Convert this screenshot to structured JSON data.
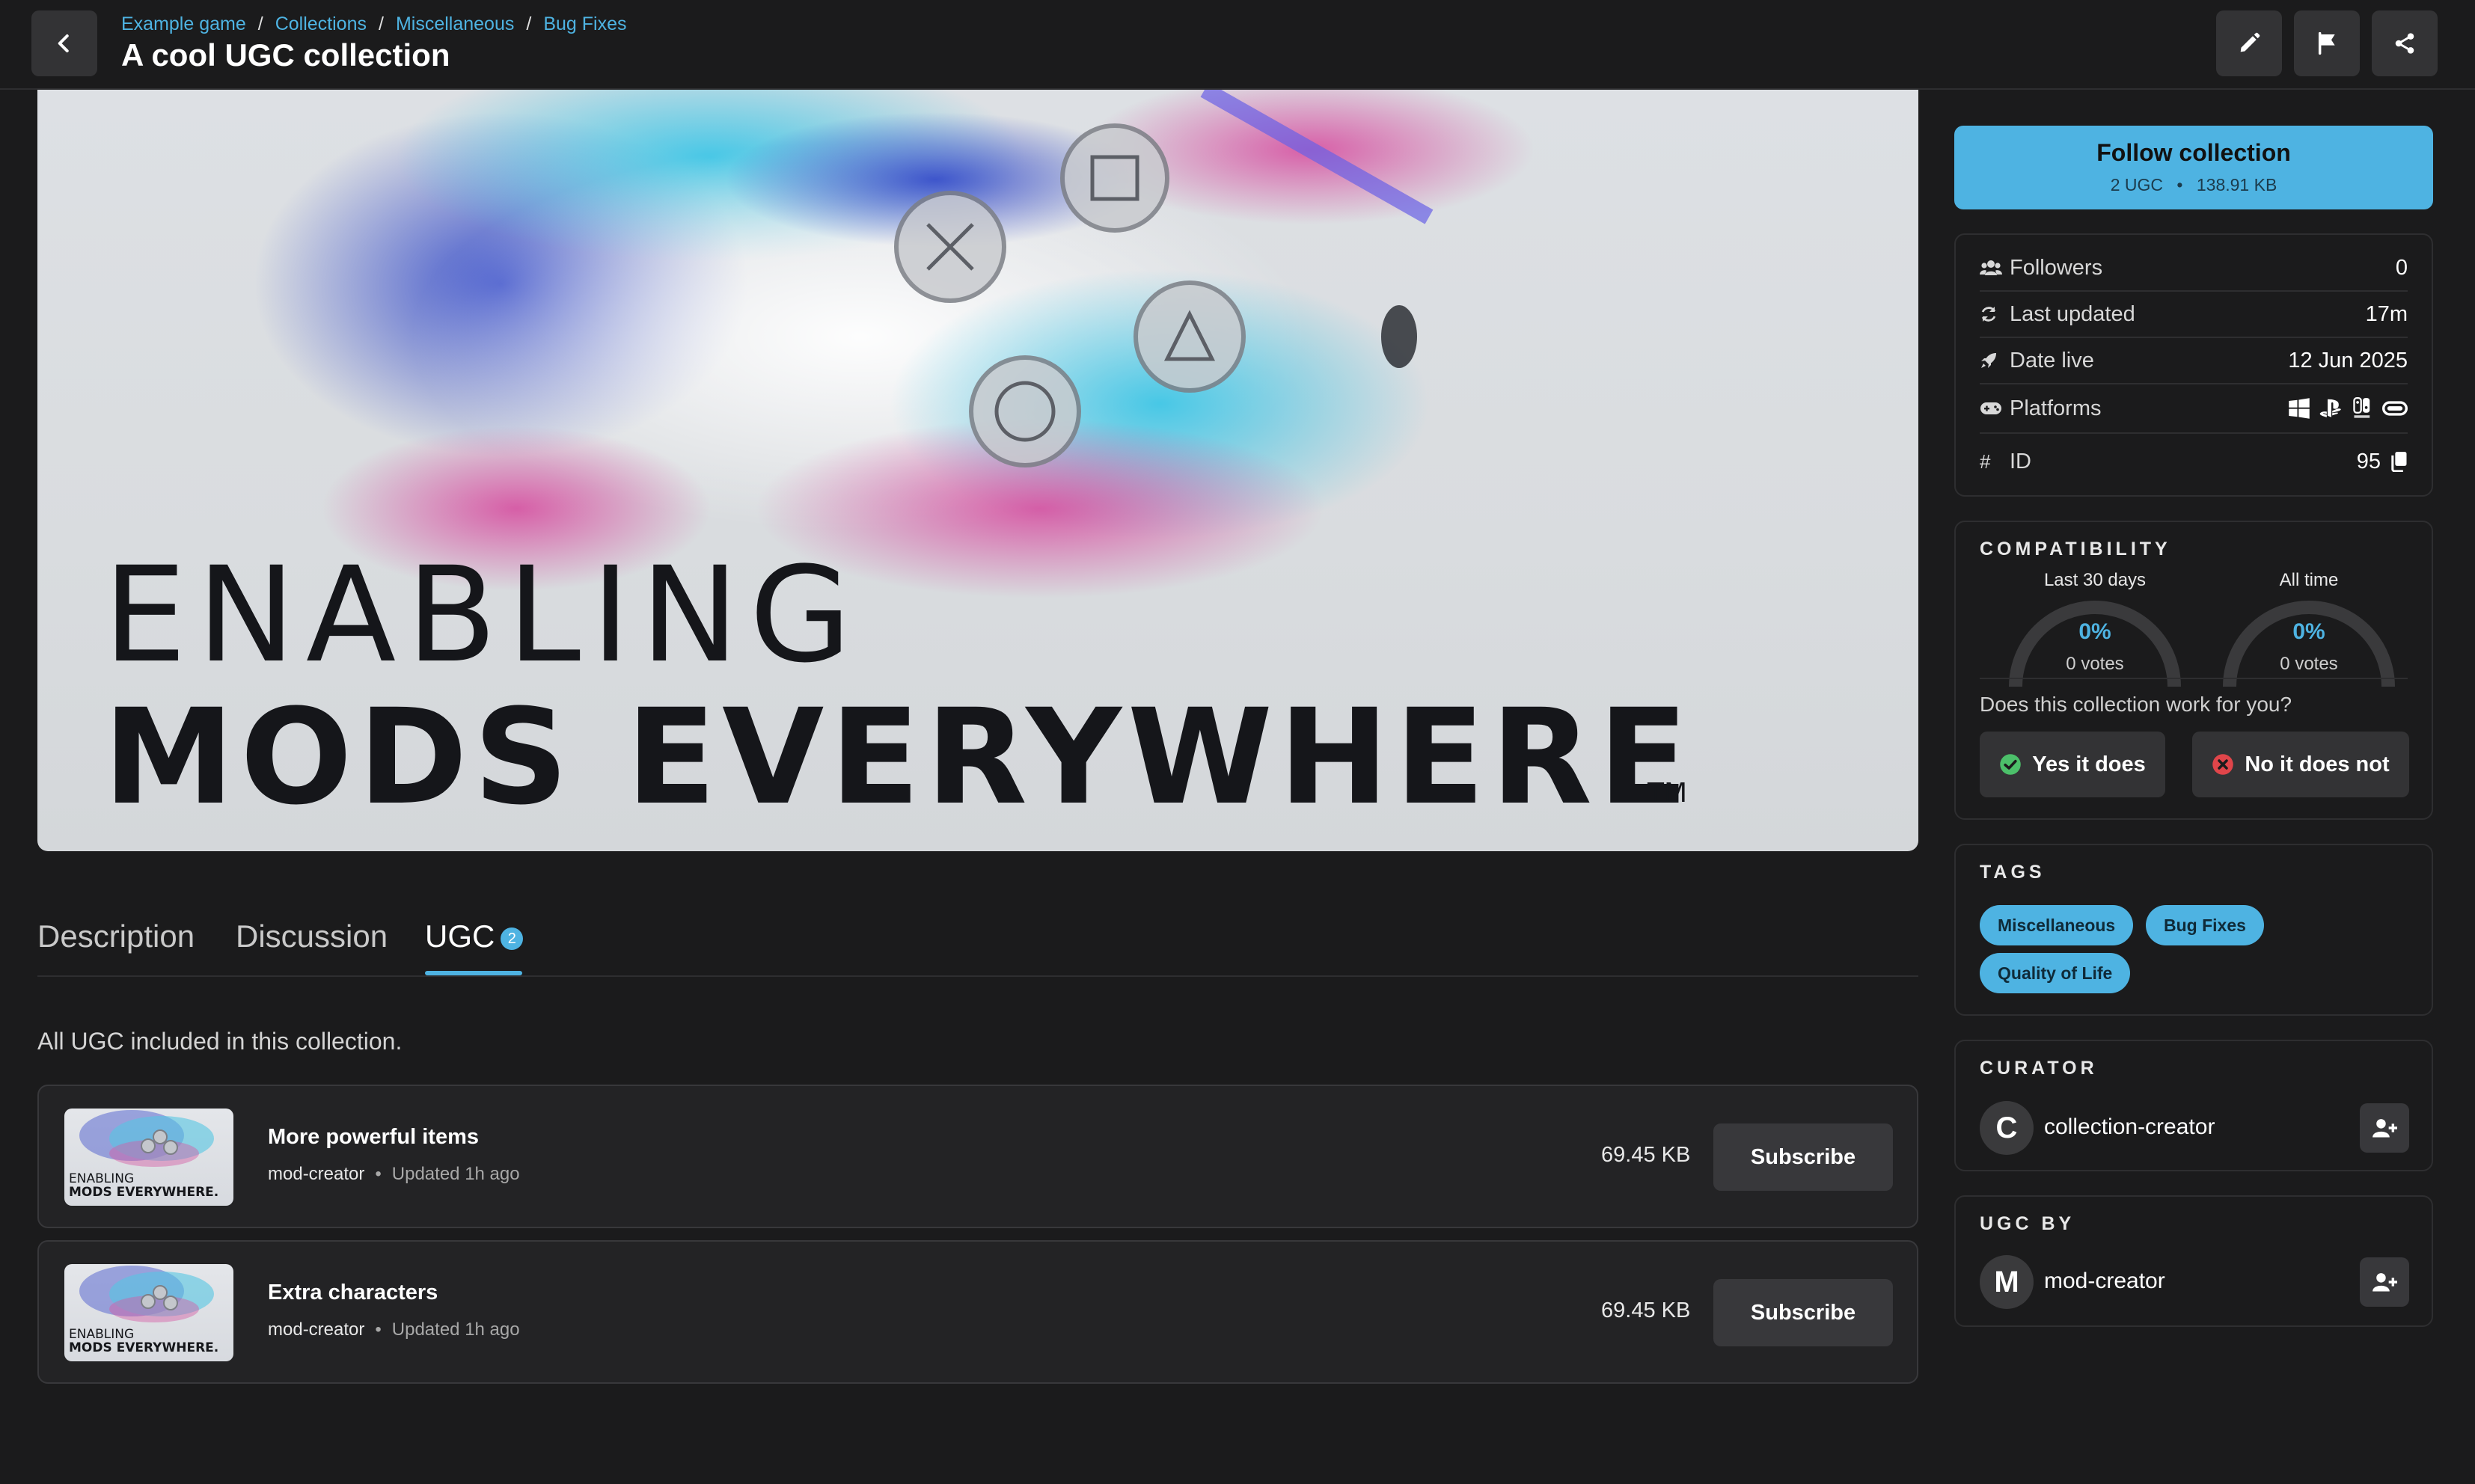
{
  "header": {
    "breadcrumbs": [
      "Example game",
      "Collections",
      "Miscellaneous",
      "Bug Fixes"
    ],
    "breadcrumb_separator": "/",
    "title": "A cool UGC collection"
  },
  "hero": {
    "line1": "ENABLING",
    "line2": "MODS EVERYWHERE",
    "trademark": "TM"
  },
  "tabs": {
    "description": "Description",
    "discussion": "Discussion",
    "ugc": "UGC",
    "ugc_count": "2"
  },
  "ugc_section": {
    "intro": "All UGC included in this collection.",
    "thumb_line1": "ENABLING",
    "thumb_line2": "MODS EVERYWHERE.",
    "items": [
      {
        "name": "More powerful items",
        "author": "mod-creator",
        "updated": "Updated 1h ago",
        "size": "69.45 KB",
        "action": "Subscribe"
      },
      {
        "name": "Extra characters",
        "author": "mod-creator",
        "updated": "Updated 1h ago",
        "size": "69.45 KB",
        "action": "Subscribe"
      }
    ]
  },
  "follow": {
    "label": "Follow collection",
    "ugc_count": "2 UGC",
    "size": "138.91 KB",
    "separator": "•"
  },
  "stats": {
    "followers_label": "Followers",
    "followers_value": "0",
    "last_updated_label": "Last updated",
    "last_updated_value": "17m",
    "date_live_label": "Date live",
    "date_live_value": "12 Jun 2025",
    "platforms_label": "Platforms",
    "platform_icons": [
      "windows-icon",
      "playstation-icon",
      "switch-icon",
      "meta-quest-icon"
    ],
    "id_label": "ID",
    "id_value": "95",
    "id_symbol": "#"
  },
  "compatibility": {
    "heading": "COMPATIBILITY",
    "last30_label": "Last 30 days",
    "last30_pct": "0%",
    "last30_votes": "0 votes",
    "alltime_label": "All time",
    "alltime_pct": "0%",
    "alltime_votes": "0 votes",
    "last30_level": 0,
    "alltime_level": 0,
    "question": "Does this collection work for you?",
    "yes": "Yes it does",
    "no": "No it does not"
  },
  "tags": {
    "heading": "TAGS",
    "items": [
      "Miscellaneous",
      "Bug Fixes",
      "Quality of Life"
    ]
  },
  "curator": {
    "heading": "CURATOR",
    "initial": "C",
    "name": "collection-creator"
  },
  "ugc_by": {
    "heading": "UGC BY",
    "initial": "M",
    "name": "mod-creator"
  },
  "colors": {
    "accent": "#4eb3e2",
    "background": "#1b1b1c",
    "surface": "#333335",
    "yes_green": "#4cc06a",
    "no_red": "#e0454a"
  }
}
